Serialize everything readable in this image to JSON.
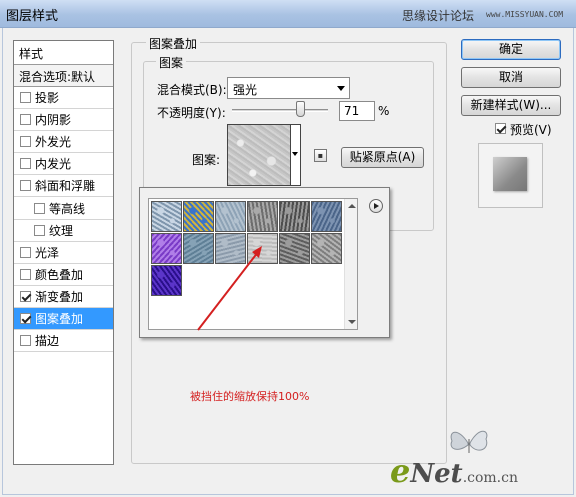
{
  "window": {
    "title": "图层样式",
    "watermark": "思缘设计论坛",
    "watermark_sub": "www.MISSYUAN.COM"
  },
  "style_list": {
    "header": "样式",
    "blend_options": "混合选项:默认",
    "items": [
      {
        "label": "投影",
        "checked": false,
        "indent": false,
        "selected": false
      },
      {
        "label": "内阴影",
        "checked": false,
        "indent": false,
        "selected": false
      },
      {
        "label": "外发光",
        "checked": false,
        "indent": false,
        "selected": false
      },
      {
        "label": "内发光",
        "checked": false,
        "indent": false,
        "selected": false
      },
      {
        "label": "斜面和浮雕",
        "checked": false,
        "indent": false,
        "selected": false
      },
      {
        "label": "等高线",
        "checked": false,
        "indent": true,
        "selected": false
      },
      {
        "label": "纹理",
        "checked": false,
        "indent": true,
        "selected": false
      },
      {
        "label": "光泽",
        "checked": false,
        "indent": false,
        "selected": false
      },
      {
        "label": "颜色叠加",
        "checked": false,
        "indent": false,
        "selected": false
      },
      {
        "label": "渐变叠加",
        "checked": true,
        "indent": false,
        "selected": false
      },
      {
        "label": "图案叠加",
        "checked": true,
        "indent": false,
        "selected": true
      },
      {
        "label": "描边",
        "checked": false,
        "indent": false,
        "selected": false
      }
    ]
  },
  "pattern_overlay": {
    "group_title": "图案叠加",
    "subgroup_title": "图案",
    "blend_mode_label": "混合模式(B):",
    "blend_mode_value": "强光",
    "opacity_label": "不透明度(Y):",
    "opacity_value": "71",
    "opacity_unit": "%",
    "opacity_level": 0.71,
    "pattern_label": "图案:",
    "snap_button": "贴紧原点(A)"
  },
  "pattern_picker": {
    "tiles": [
      {
        "name": "bubbles",
        "colors": [
          "#7f96ad",
          "#c9d6e4"
        ]
      },
      {
        "name": "tie-dye",
        "colors": [
          "#d2b43a",
          "#3c74c8"
        ]
      },
      {
        "name": "blue-grain",
        "colors": [
          "#8ea3b6",
          "#b3c2cf"
        ]
      },
      {
        "name": "gray-mesh",
        "colors": [
          "#6d6d6d",
          "#a9a9a9"
        ]
      },
      {
        "name": "dark-stone",
        "colors": [
          "#4d4d4d",
          "#9a9a9a"
        ]
      },
      {
        "name": "blue-denim",
        "colors": [
          "#4b6589",
          "#7d93b1"
        ]
      },
      {
        "name": "purple-silk",
        "colors": [
          "#7a3bc7",
          "#b07ee8"
        ]
      },
      {
        "name": "steel-blue",
        "colors": [
          "#5f7f96",
          "#86a2b6"
        ]
      },
      {
        "name": "blue-gray",
        "colors": [
          "#8c9bab",
          "#b0bcc8"
        ]
      },
      {
        "name": "light-gray-noise",
        "colors": [
          "#bcbcbc",
          "#d6d6d6"
        ]
      },
      {
        "name": "diagonal-gray",
        "colors": [
          "#5e5e5e",
          "#9c9c9c"
        ]
      },
      {
        "name": "gray-noise",
        "colors": [
          "#7e7e7e",
          "#b4b4b4"
        ]
      },
      {
        "name": "deep-purple",
        "colors": [
          "#2a0f8a",
          "#5b35c9"
        ]
      }
    ]
  },
  "note": "被挡住的缩放保持100%",
  "buttons": {
    "ok": "确定",
    "cancel": "取消",
    "new_style": "新建样式(W)...",
    "preview_label": "预览(V)",
    "preview_checked": true
  },
  "branding": {
    "e": "e",
    "net": "Net",
    "domain": ".com.cn"
  },
  "colors": {
    "selection": "#3399ff",
    "annotation": "#d42020"
  }
}
